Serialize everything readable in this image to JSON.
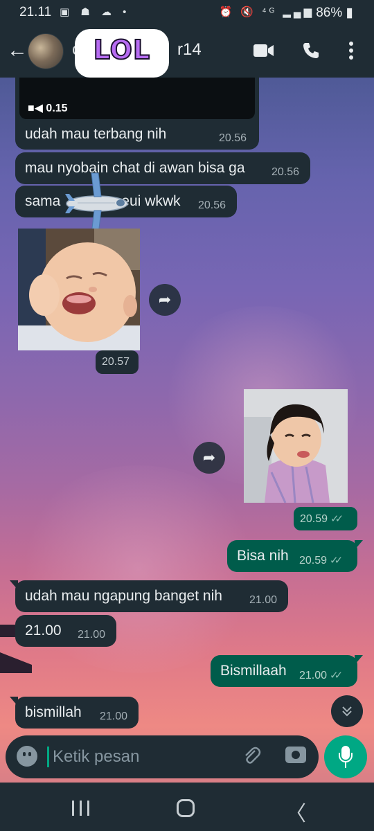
{
  "status_bar": {
    "time": "21.11",
    "left_icons": [
      "photo-icon",
      "android-icon",
      "cloud-icon",
      "dot"
    ],
    "right_icons": [
      "alarm-icon",
      "mute-icon",
      "4g-icon",
      "signal-icon"
    ],
    "battery": "86%"
  },
  "header": {
    "contact_name_visible": "r14",
    "sticker_text": "LOL"
  },
  "messages": [
    {
      "id": "m1",
      "direction": "in",
      "video_duration": "0.15",
      "text": "udah mau terbang nih",
      "time": "20.56"
    },
    {
      "id": "m2",
      "direction": "in",
      "text": "mau nyobain chat di awan bisa ga",
      "time": "20.56"
    },
    {
      "id": "m3",
      "direction": "in",
      "text_before": "sama",
      "text_after": "eui wkwk",
      "time": "20.56"
    },
    {
      "id": "m4",
      "direction": "in",
      "type": "image",
      "time": "20.57"
    },
    {
      "id": "m5",
      "direction": "out",
      "type": "image",
      "time": "20.59"
    },
    {
      "id": "m6",
      "direction": "out",
      "text": "Bisa nih",
      "time": "20.59"
    },
    {
      "id": "m7",
      "direction": "in",
      "text": "udah mau ngapung banget nih",
      "time": "21.00"
    },
    {
      "id": "m8",
      "direction": "in",
      "text": "21.00",
      "time": "21.00"
    },
    {
      "id": "m9",
      "direction": "out",
      "text": "Bismillaah",
      "time": "21.00"
    },
    {
      "id": "m10",
      "direction": "in",
      "text": "bismillah",
      "time": "21.00"
    }
  ],
  "input": {
    "placeholder": "Ketik pesan"
  },
  "colors": {
    "header_bg": "#1f2c34",
    "incoming_bubble": "#1f2c34",
    "outgoing_bubble": "#005c4b",
    "accent": "#00a884"
  }
}
